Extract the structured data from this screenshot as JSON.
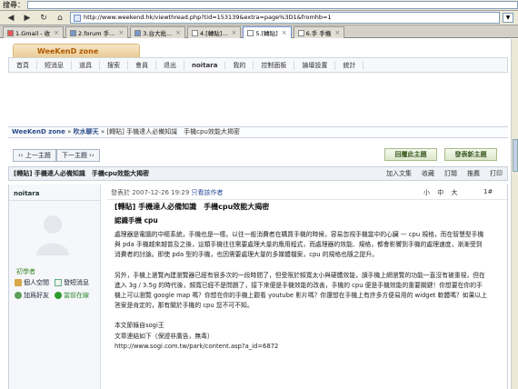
{
  "browser": {
    "search_label": "搜尋：",
    "url": "http://www.weekend.hk/viewthread.php?tid=153139&extra=page%3D1&fromhb=1",
    "tabs": [
      {
        "label": "1.Gmail - 收",
        "fav": "gmail",
        "active": false
      },
      {
        "label": "2.forum 手...",
        "fav": "forum",
        "active": false
      },
      {
        "label": "3.台大批...",
        "fav": "forum",
        "active": false
      },
      {
        "label": "4.[轉貼]...",
        "fav": "blank",
        "active": false
      },
      {
        "label": "5.[轉貼]",
        "fav": "blank",
        "active": true
      },
      {
        "label": "6.手 手機",
        "fav": "blank",
        "active": false
      }
    ]
  },
  "site": {
    "logo": "WeeKenD zone",
    "nav": [
      "首頁",
      "短消息",
      "道具",
      "搜索",
      "會員",
      "退出",
      "noitara",
      "我的",
      "控制面板",
      "論壇設置",
      "統計"
    ],
    "breadcrumb": {
      "home": "WeeKenD zone",
      "sep": "»",
      "forum": "吹水聊天",
      "thread": "[轉貼] 手機達人必備知識　手機cpu效能大揭密"
    },
    "pager": {
      "prev": "‹‹ 上一主題",
      "next": "下一主題 ››"
    },
    "buttons": {
      "reply": "回覆此主題",
      "new": "發表新主題"
    }
  },
  "thread": {
    "title": "[轉貼] 手機達人必備知識　手機cpu效能大揭密",
    "actions": [
      "加入文集",
      "收藏",
      "訂閱",
      "推薦",
      "打印"
    ]
  },
  "post": {
    "author": "noitara",
    "status": "初學者",
    "links": {
      "space": "個人空間",
      "pm": "發短消息",
      "friend": "加爲好友",
      "online": "當前在線"
    },
    "meta": "發表於 2007-12-26 19:29",
    "author_only": "只看該作者",
    "font_sizes": "小 中 大",
    "floor": "1#",
    "title": "[轉貼] 手機達人必備知識　手機cpu效能大揭密",
    "subtitle": "認識手機 cpu",
    "paragraphs": [
      "處理器是電腦的中樞系統，手機也是一樣。以往一般消費者在購買手機的時候，容易忽視手機當中的心臟 — cpu 規格，而在智慧型手機與 pda 手機越來越普及之後，這類手機往往需要處理大量的應用程式，而處理器的效能、規格，都會影響到手機的處理速度，漸漸受到消費者的討論。即使 pda 型的手機，也因需要處理大量的多媒體檔案，cpu 的規格也隨之提升。",
      "另外，手機上瀏覽內建瀏覽器已經有很多次的一段時間了，但受限於頻寬太小與硬體效能，讀手機上網瀏覽的功能一直沒有被重視，但在進入 3g / 3.5g 的時代後，頻寬已經不是問題了，接下來便是手機效能的改善，手機的 cpu 便是手機效能的重要關鍵！你想要在你的手機上可以瀏覽 google map 嗎？你想在你的手機上觀看 youtube 影片嗎？你還想在手機上有許多方便易用的 widget 軟體嗎？如果以上答案是肯定的，那有關於手機的 cpu 您不可不知。",
      "本文節錄自sogi王\n文章連結如下（保證非廣告，無毒）\nhttp://www.sogi.com.tw/park/content.asp?a_id=6872"
    ]
  }
}
